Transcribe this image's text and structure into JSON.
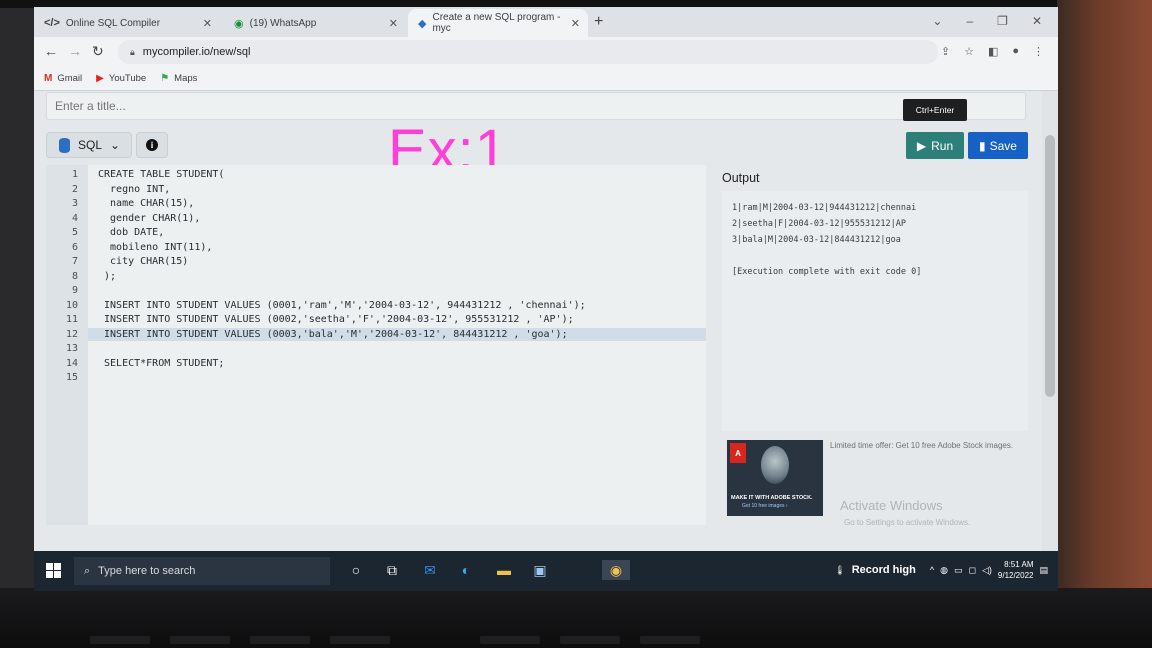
{
  "browser": {
    "tabs": [
      {
        "label": "Online SQL Compiler",
        "icon": "code-icon"
      },
      {
        "label": "(19) WhatsApp",
        "icon": "whatsapp-icon"
      },
      {
        "label": "Create a new SQL program - myc",
        "icon": "mycompiler-icon"
      }
    ],
    "url": "mycompiler.io/new/sql",
    "bookmarks": [
      {
        "label": "Gmail",
        "icon": "gmail-icon"
      },
      {
        "label": "YouTube",
        "icon": "youtube-icon"
      },
      {
        "label": "Maps",
        "icon": "maps-icon"
      }
    ]
  },
  "page": {
    "title_placeholder": "Enter a title...",
    "language": "SQL",
    "overlay_label": "Ex:1",
    "tooltip": "Ctrl+Enter",
    "run_label": "Run",
    "save_label": "Save",
    "output_title": "Output"
  },
  "editor": {
    "lines": [
      {
        "n": "1",
        "text": "CREATE TABLE STUDENT("
      },
      {
        "n": "2",
        "text": "  regno INT,"
      },
      {
        "n": "3",
        "text": "  name CHAR(15),"
      },
      {
        "n": "4",
        "text": "  gender CHAR(1),"
      },
      {
        "n": "5",
        "text": "  dob DATE,"
      },
      {
        "n": "6",
        "text": "  mobileno INT(11),"
      },
      {
        "n": "7",
        "text": "  city CHAR(15)"
      },
      {
        "n": "8",
        "text": " );"
      },
      {
        "n": "9",
        "text": ""
      },
      {
        "n": "10",
        "text": " INSERT INTO STUDENT VALUES (0001,'ram','M','2004-03-12', 944431212 , 'chennai');"
      },
      {
        "n": "11",
        "text": " INSERT INTO STUDENT VALUES (0002,'seetha','F','2004-03-12', 955531212 , 'AP');"
      },
      {
        "n": "12",
        "text": " INSERT INTO STUDENT VALUES (0003,'bala','M','2004-03-12', 844431212 , 'goa');"
      },
      {
        "n": "13",
        "text": ""
      },
      {
        "n": "14",
        "text": " SELECT*FROM STUDENT;"
      },
      {
        "n": "15",
        "text": ""
      }
    ],
    "active_line": 12
  },
  "output": {
    "lines": [
      "1|ram|M|2004-03-12|944431212|chennai",
      "2|seetha|F|2004-03-12|955531212|AP",
      "3|bala|M|2004-03-12|844431212|goa",
      "",
      "[Execution complete with exit code 0]"
    ]
  },
  "ad": {
    "text": "Limited time offer: Get 10 free Adobe Stock images.",
    "badge": "Adobe",
    "tagline": "MAKE IT WITH ADOBE STOCK.",
    "subline": "Get 10 free images ›"
  },
  "watermark": {
    "line1": "Activate Windows",
    "line2": "Go to Settings to activate Windows."
  },
  "taskbar": {
    "search_placeholder": "Type here to search",
    "weather": "Record high",
    "time": "8:51 AM",
    "date": "9/12/2022"
  },
  "colors": {
    "run": "#2d7f79",
    "save": "#1760c4",
    "overlay": "#ff3fd6"
  }
}
